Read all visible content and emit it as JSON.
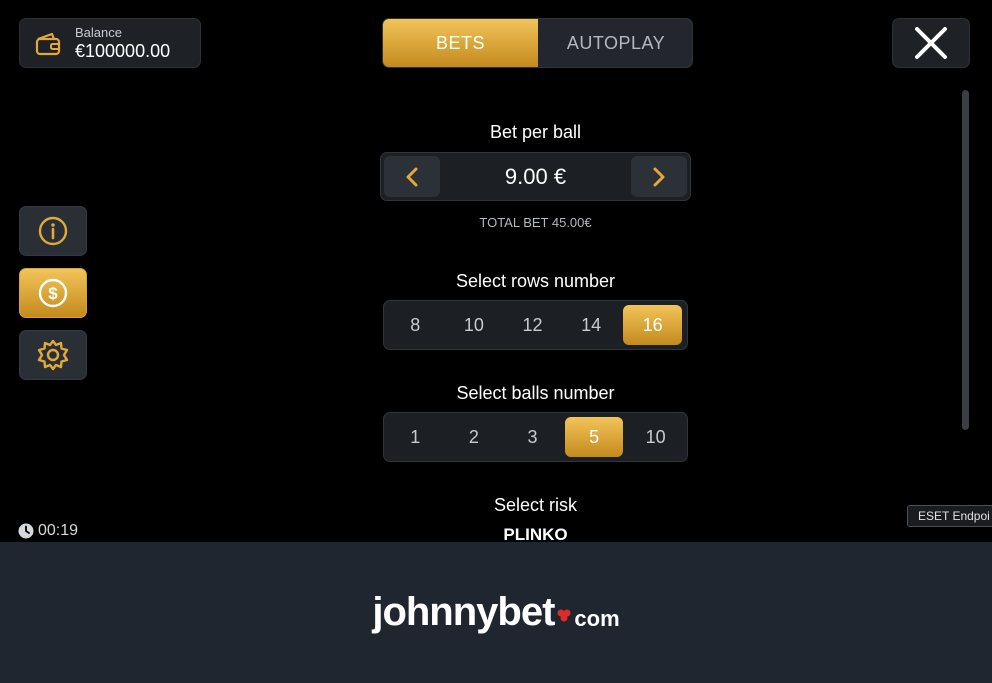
{
  "balance": {
    "label": "Balance",
    "value": "€100000.00"
  },
  "tabs": [
    {
      "label": "BETS",
      "active": true
    },
    {
      "label": "AUTOPLAY",
      "active": false
    }
  ],
  "bet": {
    "title": "Bet per ball",
    "value": "9.00 €",
    "total": "TOTAL BET 45.00€"
  },
  "rows": {
    "title": "Select rows number",
    "options": [
      "8",
      "10",
      "12",
      "14",
      "16"
    ],
    "selected": "16"
  },
  "balls": {
    "title": "Select balls number",
    "options": [
      "1",
      "2",
      "3",
      "5",
      "10"
    ],
    "selected": "5"
  },
  "risk": {
    "title": "Select risk",
    "game_name": "PLINKO"
  },
  "timer": "00:19",
  "eset_badge": "ESET Endpoi",
  "footer": {
    "logo_main": "johnnybet",
    "logo_suffix": "com"
  },
  "colors": {
    "accent": "#e0a93a",
    "panel": "#1e2227",
    "footer": "#1f2630"
  },
  "icons": {
    "wallet": "wallet-icon",
    "close": "close-icon",
    "info": "info-icon",
    "coin": "dollar-coin-icon",
    "settings": "gear-icon",
    "prev": "chevron-left-icon",
    "next": "chevron-right-icon",
    "clock": "clock-icon"
  }
}
